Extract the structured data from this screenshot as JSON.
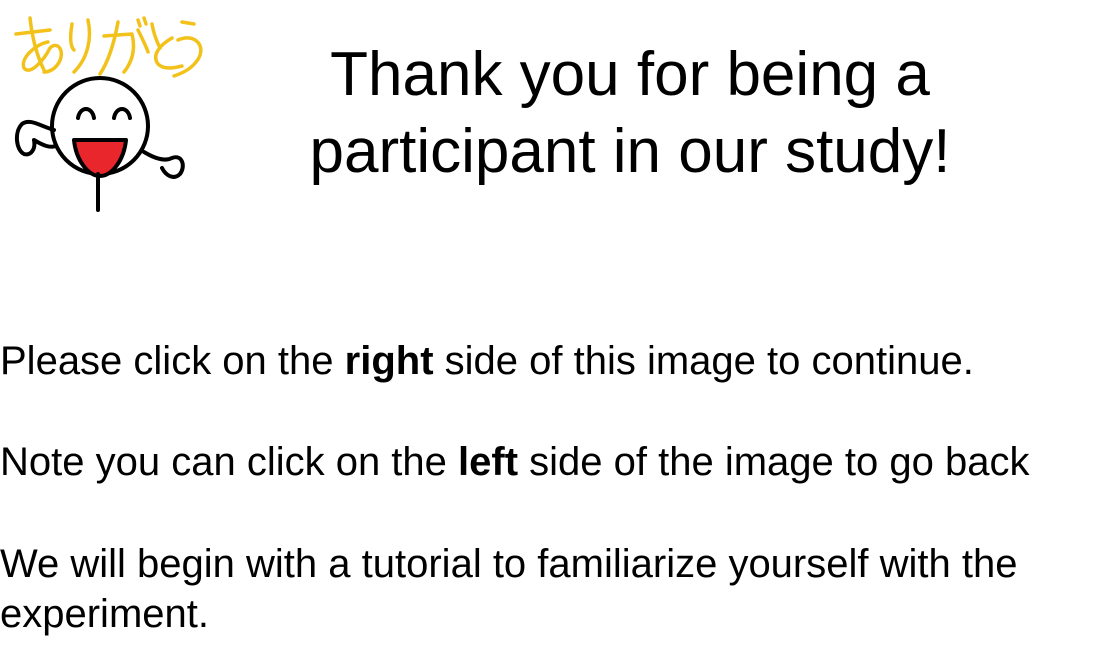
{
  "mascot": {
    "caption": "ありがとう",
    "icon": "smiling-stick-figure-icon",
    "caption_color": "#F2C21B",
    "mouth_color": "#E8262B"
  },
  "title": {
    "line1": "Thank you for being a",
    "line2": "participant in our study!"
  },
  "instructions": {
    "continue": {
      "before": "Please click on the ",
      "bold": "right",
      "after": " side of this image to continue."
    },
    "back": {
      "before": "Note you can click on the ",
      "bold": "left",
      "after": " side of the image to go back"
    },
    "tutorial": "We will begin with a tutorial to familiarize yourself with the experiment."
  }
}
